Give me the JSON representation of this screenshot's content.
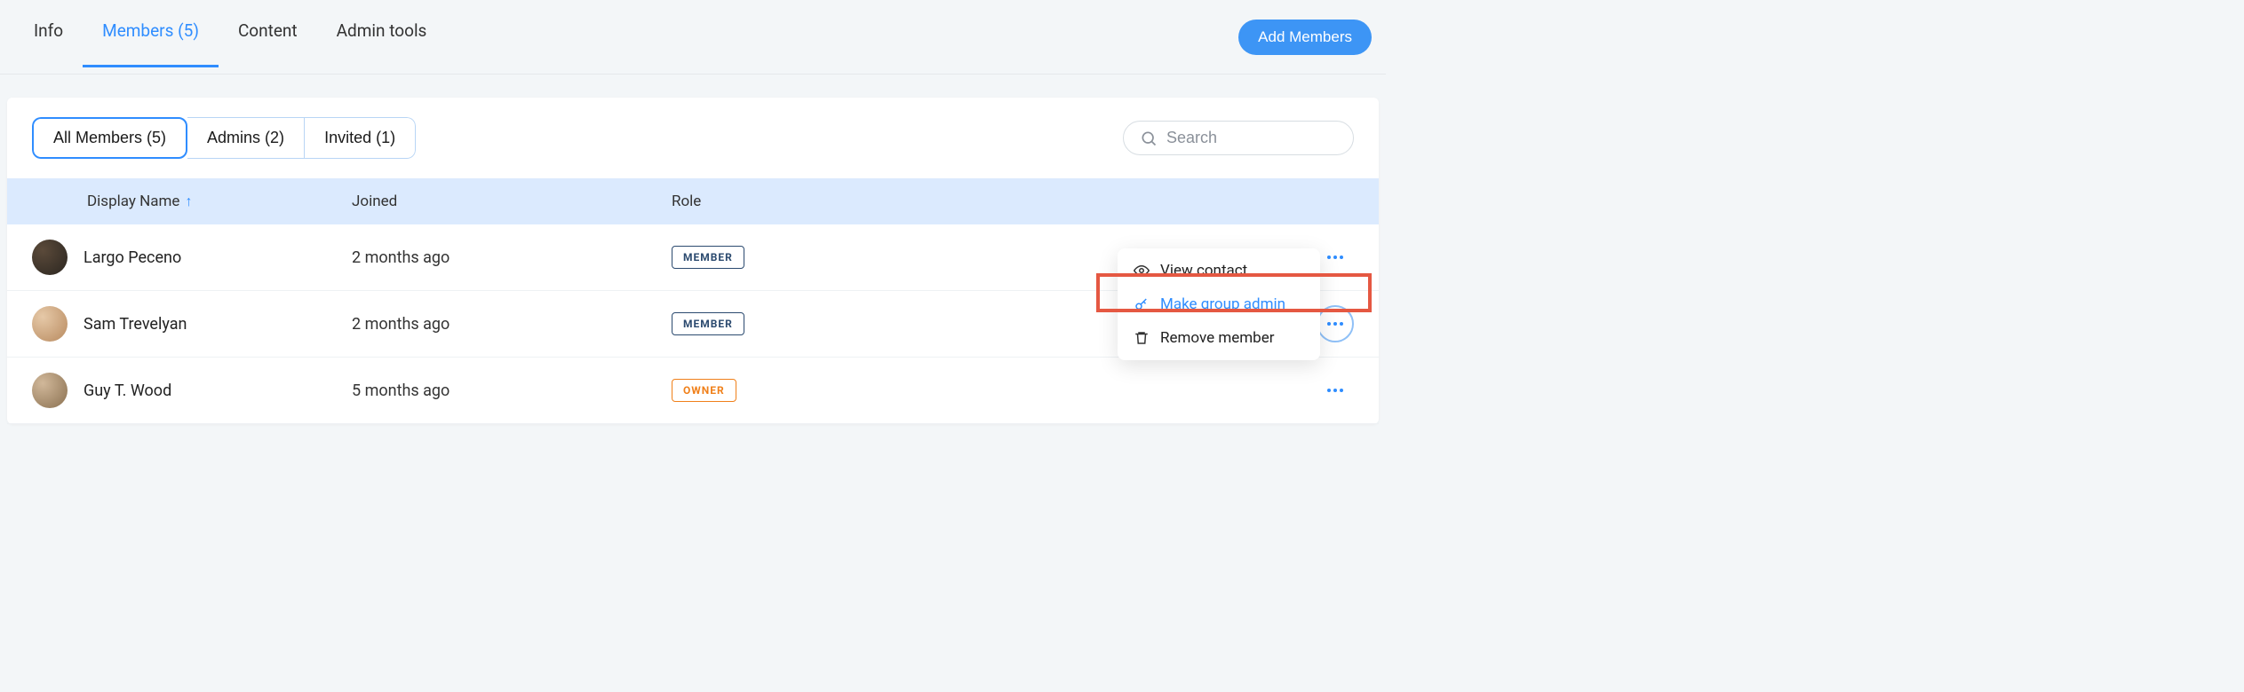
{
  "navbar": {
    "tabs": [
      {
        "label": "Info"
      },
      {
        "label": "Members (5)"
      },
      {
        "label": "Content"
      },
      {
        "label": "Admin tools"
      }
    ],
    "add_button_label": "Add Members"
  },
  "filters": [
    {
      "label": "All Members (5)"
    },
    {
      "label": "Admins (2)"
    },
    {
      "label": "Invited (1)"
    }
  ],
  "search": {
    "placeholder": "Search"
  },
  "columns": {
    "name": "Display Name",
    "joined": "Joined",
    "role": "Role"
  },
  "rows": [
    {
      "name": "Largo Peceno",
      "joined": "2 months ago",
      "role": "MEMBER",
      "role_kind": "member"
    },
    {
      "name": "Sam Trevelyan",
      "joined": "2 months ago",
      "role": "MEMBER",
      "role_kind": "member"
    },
    {
      "name": "Guy T. Wood",
      "joined": "5 months ago",
      "role": "OWNER",
      "role_kind": "owner"
    }
  ],
  "dropdown": {
    "view": "View contact",
    "make_admin": "Make group admin",
    "remove": "Remove member"
  }
}
